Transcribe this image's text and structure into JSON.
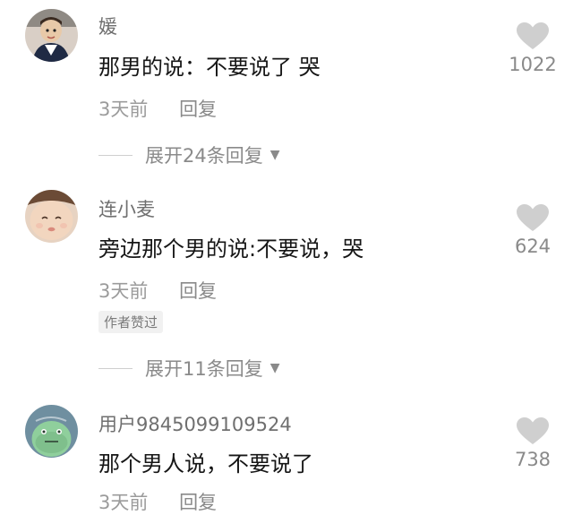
{
  "comments": [
    {
      "username": "媛",
      "text": "那男的说：不要说了 哭",
      "time": "3天前",
      "reply_label": "回复",
      "likes": "1022",
      "expand_label": "展开24条回复"
    },
    {
      "username": "连小麦",
      "text": "旁边那个男的说:不要说，哭",
      "time": "3天前",
      "reply_label": "回复",
      "badge": "作者赞过",
      "likes": "624",
      "expand_label": "展开11条回复"
    },
    {
      "username": "用户9845099109524",
      "text": "那个男人说，不要说了",
      "time": "3天前",
      "reply_label": "回复",
      "likes": "738"
    }
  ],
  "colors": {
    "heart": "#cfcfcf",
    "text": "#161616",
    "secondary": "#9b9b9b"
  },
  "icons": {
    "like": "heart-icon",
    "expand": "triangle-down-icon"
  }
}
